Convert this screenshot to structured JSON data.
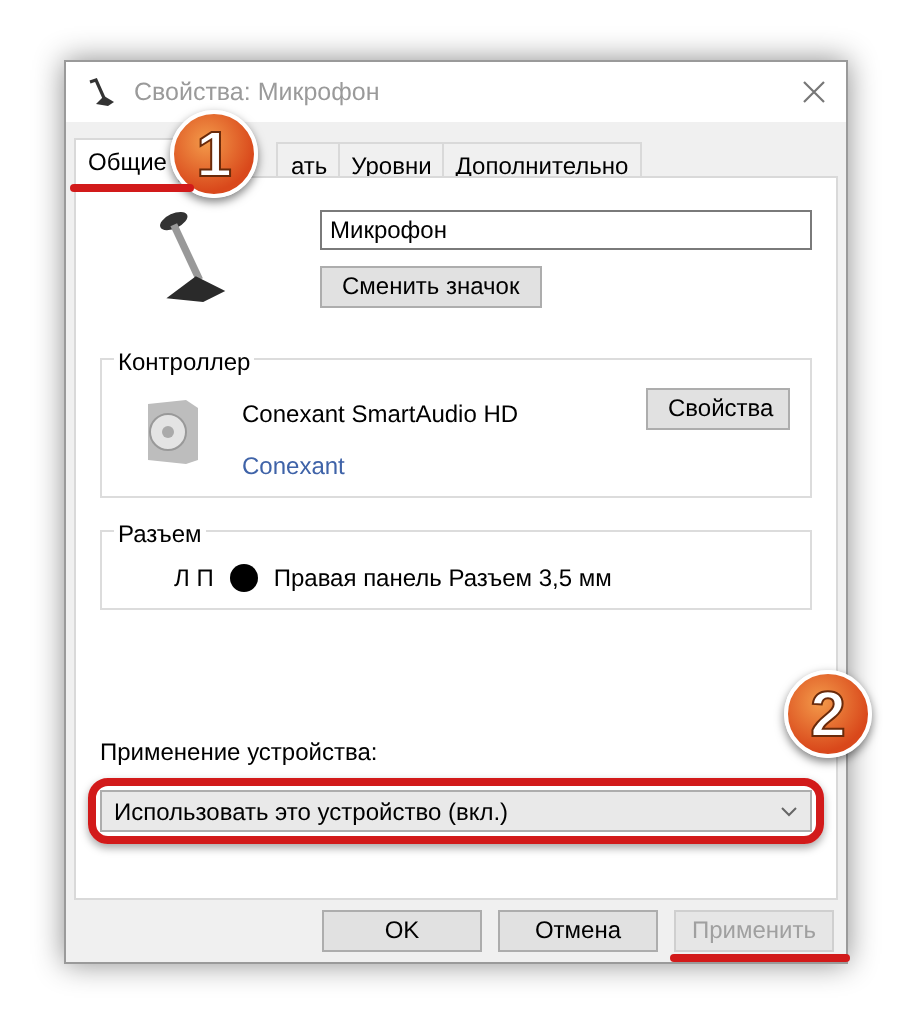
{
  "window": {
    "title": "Свойства: Микрофон"
  },
  "tabs": {
    "callout": "1",
    "items": [
      {
        "label": "Общие",
        "selected": true,
        "underlined": true
      },
      {
        "label": "ать",
        "selected": false,
        "underlined": false
      },
      {
        "label": "Уровни",
        "selected": false,
        "underlined": false
      },
      {
        "label": "Дополнительно",
        "selected": false,
        "underlined": false
      }
    ]
  },
  "device": {
    "name": "Микрофон",
    "change_icon_button": "Сменить значок"
  },
  "controller": {
    "legend": "Контроллер",
    "name": "Conexant SmartAudio HD",
    "vendor": "Conexant",
    "button": "Свойства"
  },
  "jack": {
    "legend": "Разъем",
    "channels": "Л П",
    "color": "#000000",
    "description": "Правая панель Разъем 3,5 мм"
  },
  "usage": {
    "label": "Применение устройства:",
    "value": "Использовать это устройство (вкл.)",
    "callout": "2",
    "framed": true
  },
  "buttons": [
    {
      "label": "OK",
      "disabled": false,
      "underlined": false
    },
    {
      "label": "Отмена",
      "disabled": false,
      "underlined": false
    },
    {
      "label": "Применить",
      "disabled": true,
      "underlined": true
    }
  ]
}
